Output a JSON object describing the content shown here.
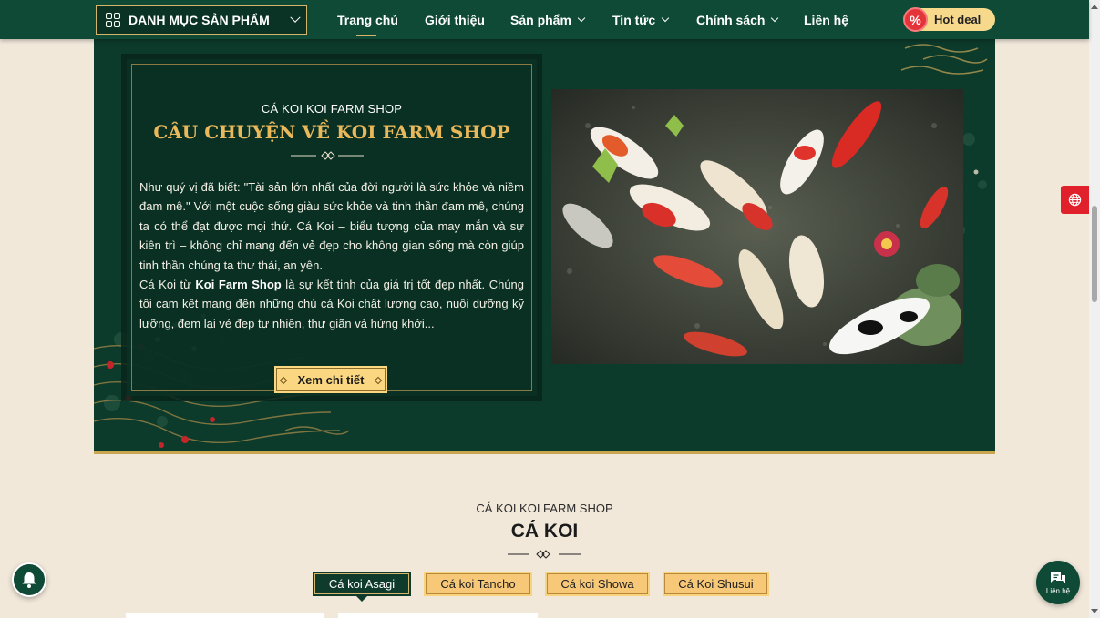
{
  "header": {
    "category_button": "DANH MỤC SẢN PHẨM",
    "nav": [
      {
        "label": "Trang chủ",
        "active": true,
        "dropdown": false
      },
      {
        "label": "Giới thiệu",
        "active": false,
        "dropdown": false
      },
      {
        "label": "Sản phẩm",
        "active": false,
        "dropdown": true
      },
      {
        "label": "Tin tức",
        "active": false,
        "dropdown": true
      },
      {
        "label": "Chính sách",
        "active": false,
        "dropdown": true
      },
      {
        "label": "Liên hệ",
        "active": false,
        "dropdown": false
      }
    ],
    "hot_deal": {
      "badge": "%",
      "label": "Hot deal"
    }
  },
  "story": {
    "kicker": "CÁ KOI KOI FARM SHOP",
    "title": "CÂU CHUYỆN VỀ KOI FARM SHOP",
    "paragraph1": "Như quý vị đã biết: \"Tài sản lớn nhất của đời người là sức khỏe và niềm đam mê.\" Với một cuộc sống giàu sức khỏe và tinh thần đam mê, chúng ta có thể đạt được mọi thứ. Cá Koi – biểu tượng của may mắn và sự kiên trì – không chỉ mang đến vẻ đẹp cho không gian sống mà còn giúp tinh thần chúng ta thư thái, an yên.",
    "paragraph2_prefix": "Cá Koi từ ",
    "paragraph2_brand": "Koi Farm Shop",
    "paragraph2_suffix": " là sự kết tinh của giá trị tốt đẹp nhất. Chúng tôi cam kết mang đến những chú cá Koi chất lượng cao, nuôi dưỡng kỹ lưỡng, đem lại vẻ đẹp tự nhiên, thư giãn và hứng khởi...",
    "button": "Xem chi tiết"
  },
  "koi_section": {
    "kicker": "CÁ KOI KOI FARM SHOP",
    "title": "CÁ KOI",
    "tabs": [
      {
        "label": "Cá koi Asagi",
        "active": true
      },
      {
        "label": "Cá koi Tancho",
        "active": false
      },
      {
        "label": "Cá koi Showa",
        "active": false
      },
      {
        "label": "Cá Koi Shusui",
        "active": false
      }
    ]
  },
  "widgets": {
    "contact_label": "Liên hệ"
  },
  "colors": {
    "brand_green": "#0e4a35",
    "gold": "#e9b85b",
    "button_gold": "#fbd782",
    "page_bg": "#f1e8da",
    "alert_red": "#e0202b"
  }
}
